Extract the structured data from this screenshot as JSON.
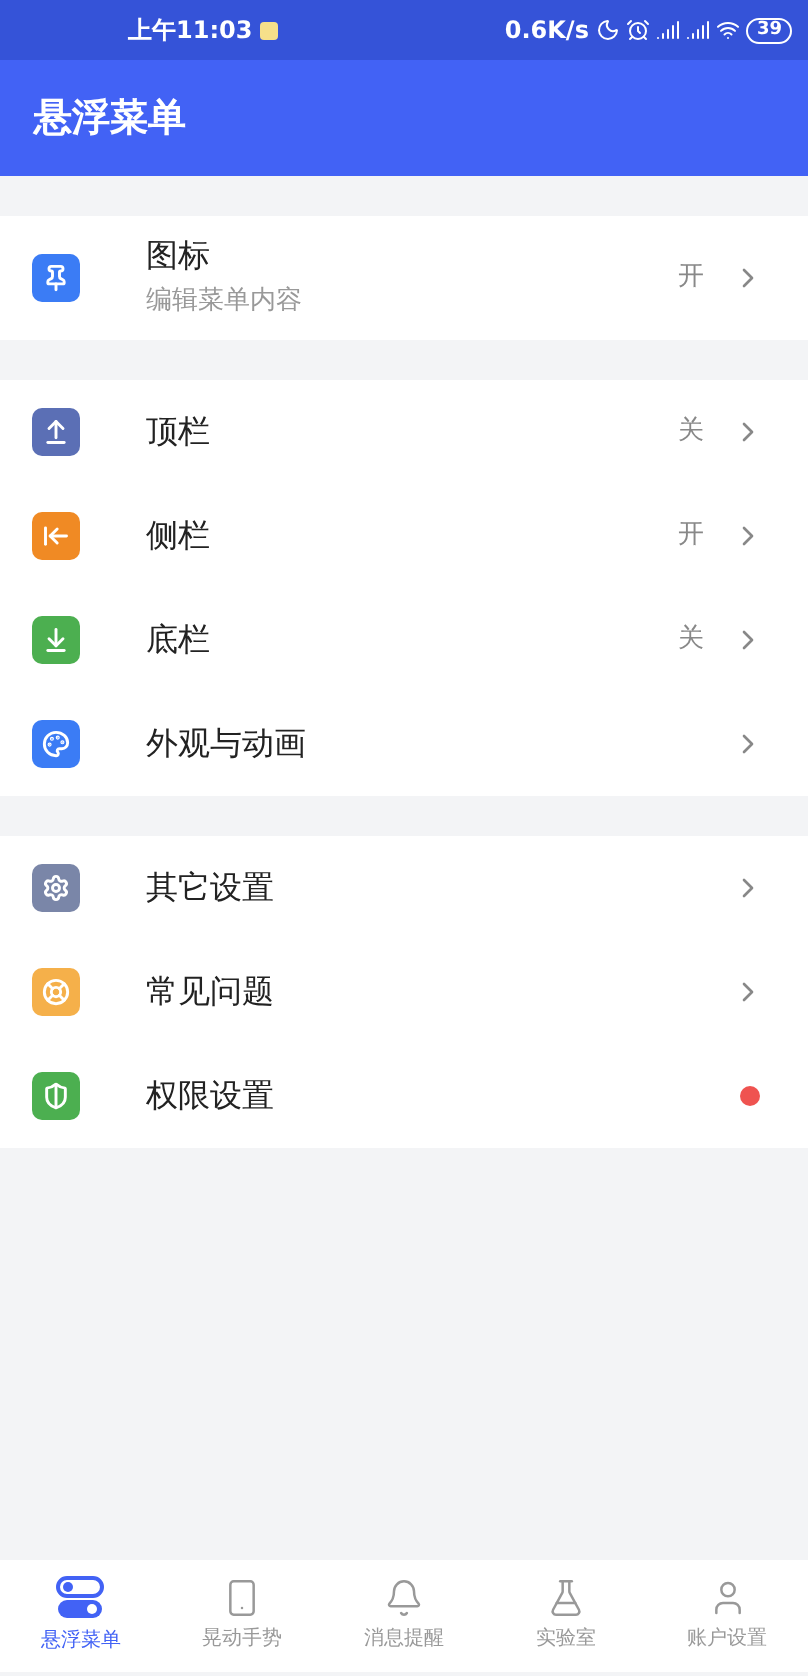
{
  "status_bar": {
    "time": "上午11:03",
    "speed": "0.6K/s",
    "battery": "39"
  },
  "app_bar": {
    "title": "悬浮菜单"
  },
  "sections": [
    {
      "items": [
        {
          "title": "图标",
          "subtitle": "编辑菜单内容",
          "kind": "value",
          "value": "开",
          "color": "#3b7cf5"
        }
      ]
    },
    {
      "items": [
        {
          "title": "顶栏",
          "kind": "value",
          "value": "关",
          "color": "#5b6fb5"
        },
        {
          "title": "侧栏",
          "kind": "value",
          "value": "开",
          "color": "#f08a24"
        },
        {
          "title": "底栏",
          "kind": "value",
          "value": "关",
          "color": "#4caf50"
        },
        {
          "title": "外观与动画",
          "kind": "link",
          "color": "#3b7cf5"
        }
      ]
    },
    {
      "items": [
        {
          "title": "其它设置",
          "kind": "link",
          "color": "#7a86a8"
        },
        {
          "title": "常见问题",
          "kind": "link",
          "color": "#f5b04a"
        },
        {
          "title": "权限设置",
          "kind": "dot",
          "color": "#4caf50"
        }
      ]
    }
  ],
  "bottom_nav": [
    {
      "label": "悬浮菜单",
      "selected": true
    },
    {
      "label": "晃动手势",
      "selected": false
    },
    {
      "label": "消息提醒",
      "selected": false
    },
    {
      "label": "实验室",
      "selected": false
    },
    {
      "label": "账户设置",
      "selected": false
    }
  ]
}
